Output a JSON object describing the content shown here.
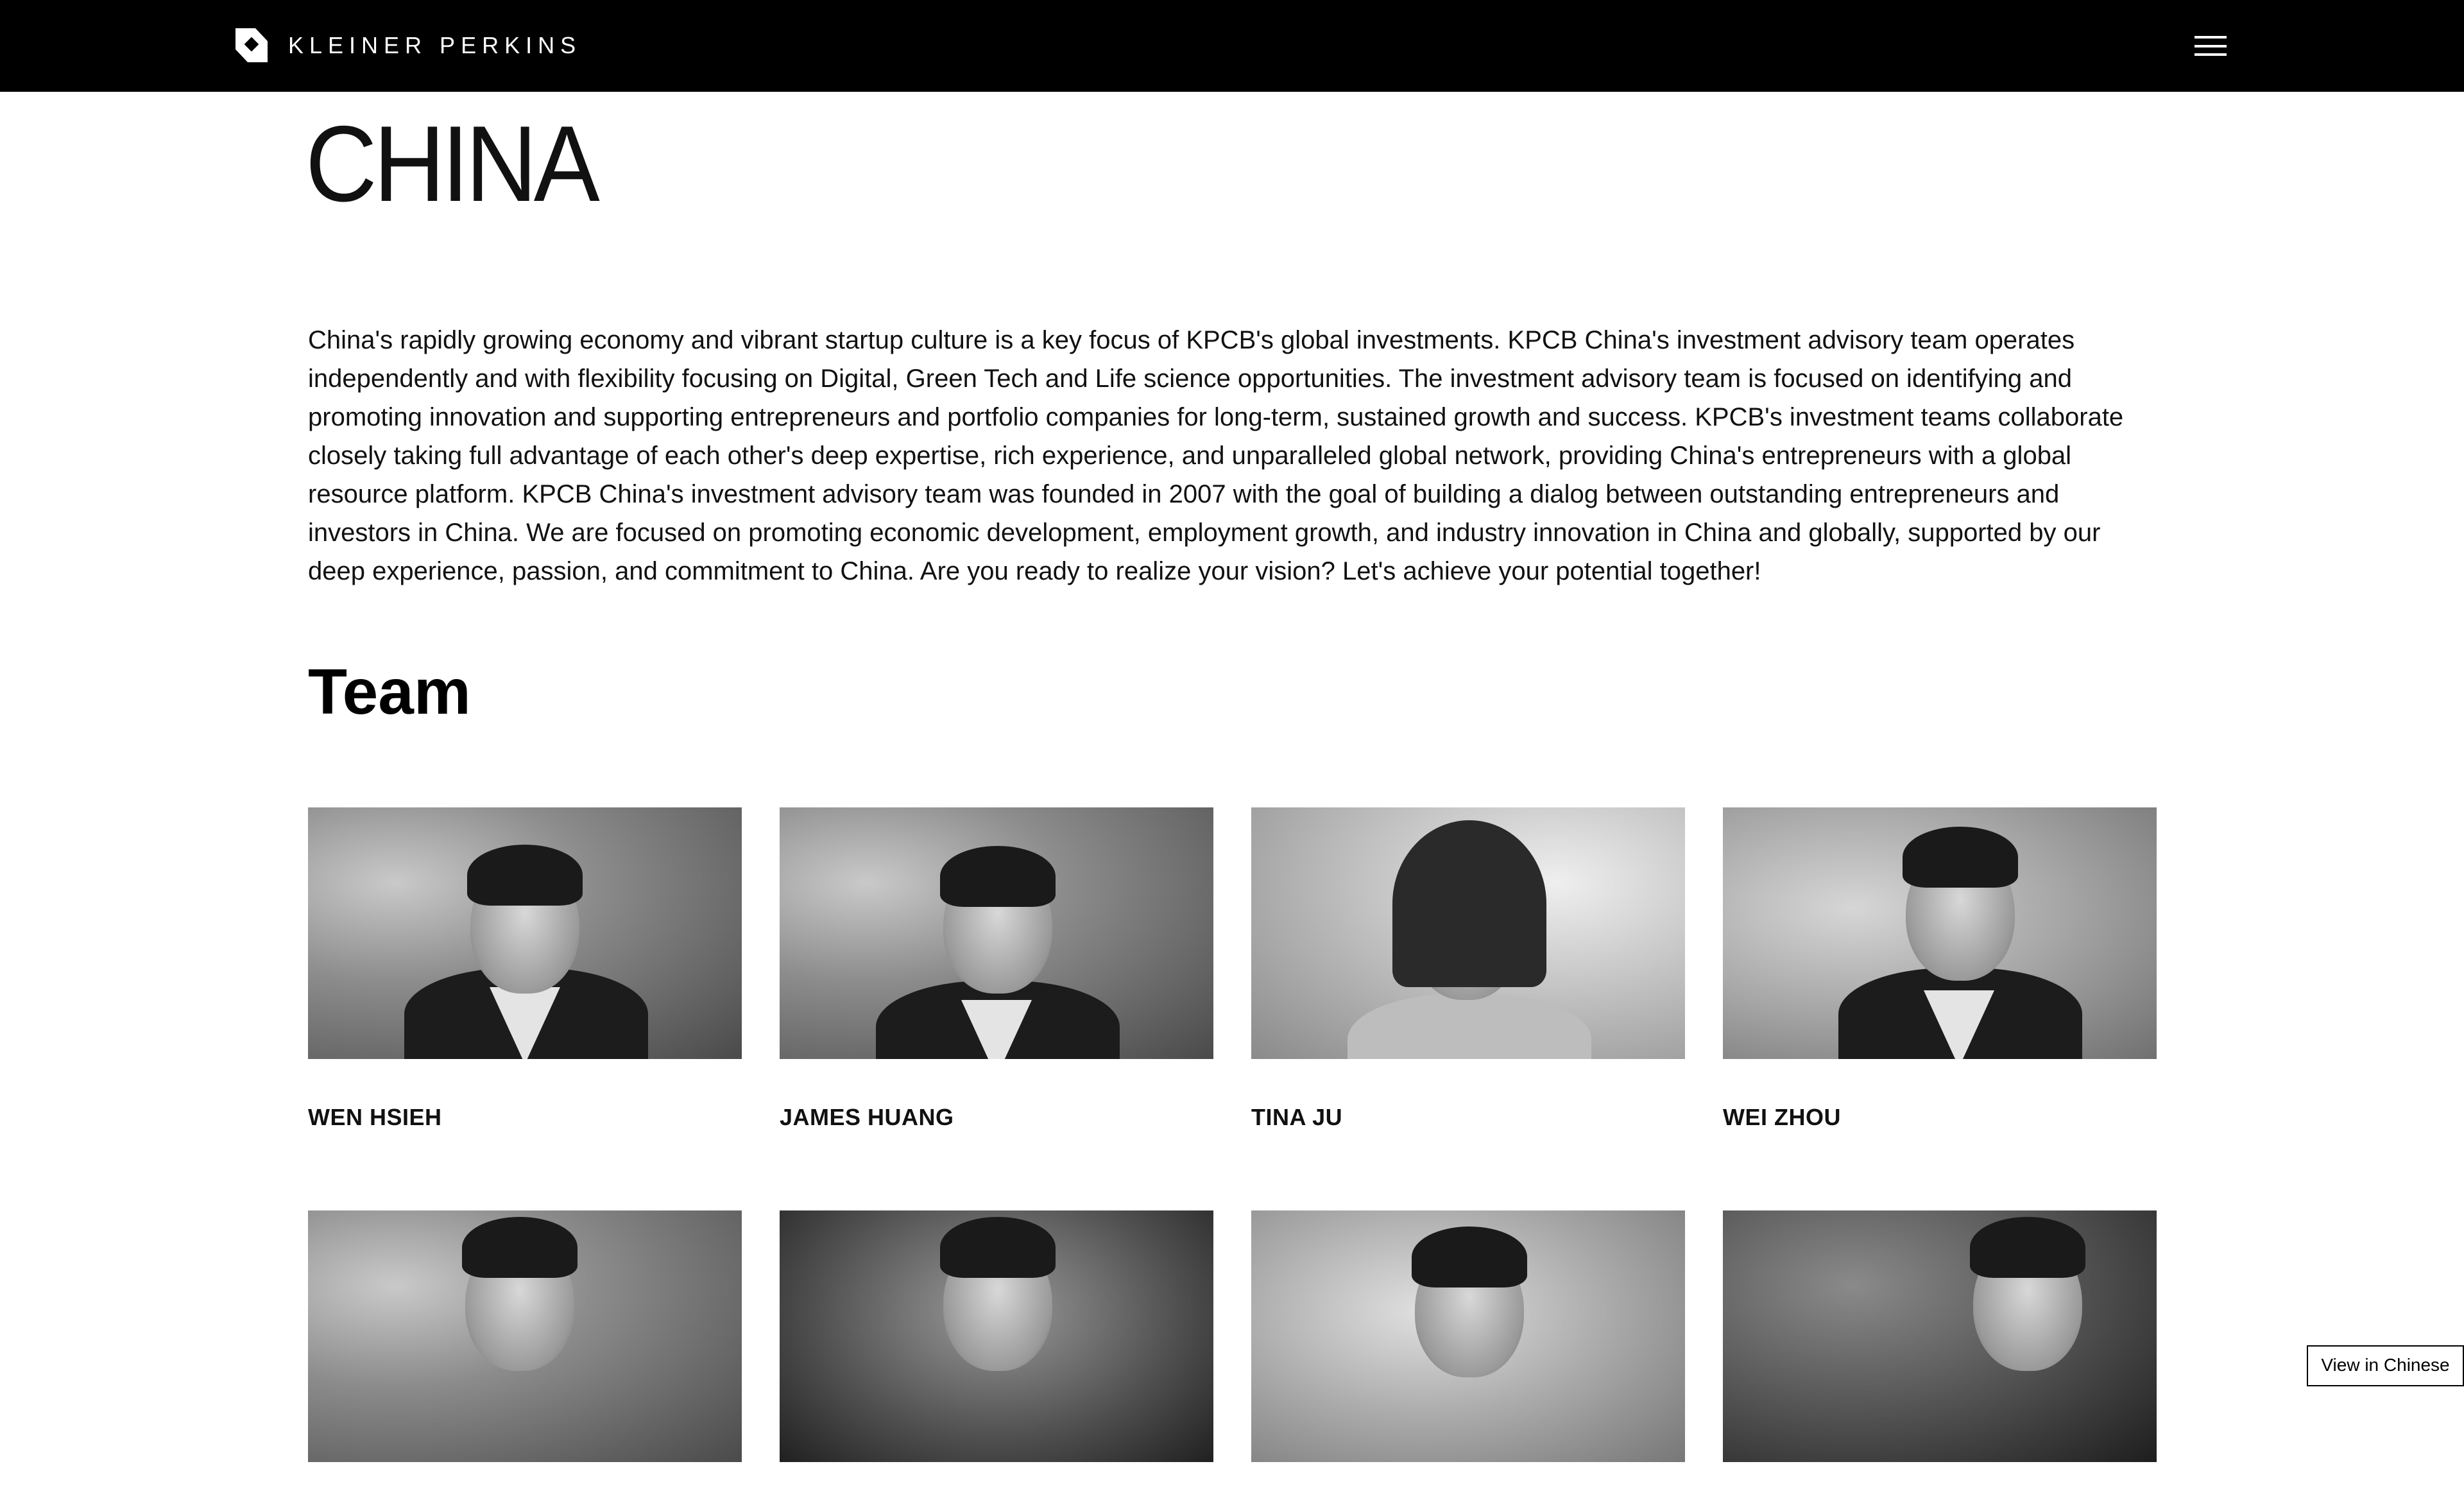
{
  "header": {
    "logo_text": "KLEINER PERKINS",
    "logo_icon": "kleiner-perkins-logo-icon",
    "menu_icon": "hamburger-menu-icon"
  },
  "page": {
    "title": "CHINA",
    "intro": "China's rapidly growing economy and vibrant startup culture is a key focus of KPCB's global investments. KPCB China's investment advisory team operates independently and with flexibility focusing on Digital, Green Tech and Life science opportunities. The investment advisory team is focused on identifying and promoting innovation and supporting entrepreneurs and portfolio companies for long-term, sustained growth and success. KPCB's investment teams collaborate closely taking full advantage of each other's deep expertise, rich experience, and unparalleled global network, providing China's entrepreneurs with a global resource platform. KPCB China's investment advisory team was founded in 2007 with the goal of building a dialog between outstanding entrepreneurs and investors in China. We are focused on promoting economic development, employment growth, and industry innovation in China and globally, supported by our deep experience, passion, and commitment to China. Are you ready to realize your vision? Let's achieve your potential together!",
    "team_heading": "Team"
  },
  "team": [
    {
      "name": "WEN HSIEH"
    },
    {
      "name": "JAMES HUANG"
    },
    {
      "name": "TINA JU"
    },
    {
      "name": "WEI ZHOU"
    },
    {
      "name": ""
    },
    {
      "name": ""
    },
    {
      "name": ""
    },
    {
      "name": ""
    }
  ],
  "language_toggle": {
    "label": "View in Chinese"
  }
}
